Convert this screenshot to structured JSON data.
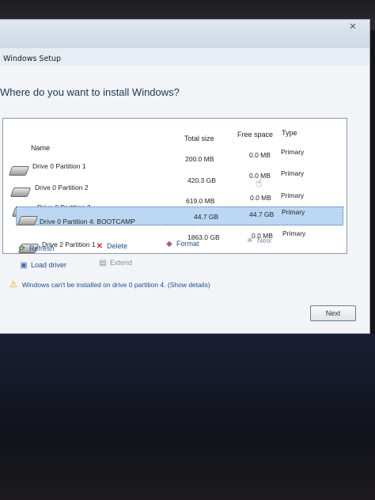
{
  "window": {
    "title": "Windows Setup",
    "close_glyph": "✕"
  },
  "heading": "Where do you want to install Windows?",
  "table": {
    "columns": {
      "name": "Name",
      "total_size": "Total size",
      "free_space": "Free space",
      "type": "Type"
    },
    "rows": [
      {
        "name": "Drive 0 Partition 1",
        "total": "200.0 MB",
        "free": "0.0 MB",
        "type": "Primary",
        "selected": false
      },
      {
        "name": "Drive 0 Partition 2",
        "total": "420.3 GB",
        "free": "0.0 MB",
        "type": "Primary",
        "selected": false
      },
      {
        "name": "Drive 0 Partition 3",
        "total": "619.0 MB",
        "free": "0.0 MB",
        "type": "Primary",
        "selected": false
      },
      {
        "name": "Drive 0 Partition 4: BOOTCAMP",
        "total": "44.7 GB",
        "free": "44.7 GB",
        "type": "Primary",
        "selected": true
      },
      {
        "name": "Drive 2 Partition 1",
        "total": "1863.0 GB",
        "free": "0.0 MB",
        "type": "Primary",
        "selected": false
      }
    ]
  },
  "actions": {
    "refresh": "Refresh",
    "delete": "Delete",
    "format": "Format",
    "new": "New",
    "load_driver": "Load driver",
    "extend": "Extend"
  },
  "warning": "Windows can't be installed on drive 0 partition 4.  (Show details)",
  "next_button": "Next",
  "colors": {
    "selection": "#bcd7f3",
    "link": "#1f4e8f",
    "warning_icon": "#d9a400"
  }
}
